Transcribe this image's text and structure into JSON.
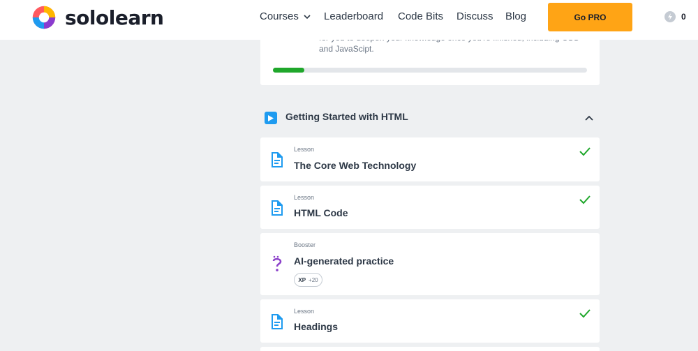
{
  "header": {
    "brand": "sololearn",
    "nav": [
      "Courses",
      "Leaderboard",
      "Code Bits",
      "Discuss",
      "Blog"
    ],
    "go_pro_label": "Go PRO",
    "energy_count": "0"
  },
  "module": {
    "description_partial": "for you to deepen your knowledge once you're finished, including CSS and JavaScipt.",
    "progress": 0.1
  },
  "section": {
    "title": "Getting Started with HTML"
  },
  "items": [
    {
      "type": "Lesson",
      "title": "The Core Web Technology",
      "completed": true
    },
    {
      "type": "Lesson",
      "title": "HTML Code",
      "completed": true
    },
    {
      "type": "Booster",
      "title": "AI-generated practice",
      "xp_label": "XP",
      "xp_value": "+20"
    },
    {
      "type": "Lesson",
      "title": "Headings",
      "completed": true
    }
  ],
  "colors": {
    "accent": "#ffa415",
    "success": "#1fa72b",
    "lesson_icon": "#1e9bf0",
    "booster_icon": "#8b40c9"
  },
  "icons": {
    "logo": "sololearn-logo-icon",
    "courses_dropdown": "chevron-down-icon",
    "energy": "bolt-icon",
    "section": "play-icon",
    "collapse": "chevron-up-icon",
    "lesson": "document-icon",
    "booster": "question-icon",
    "completed": "check-icon"
  }
}
